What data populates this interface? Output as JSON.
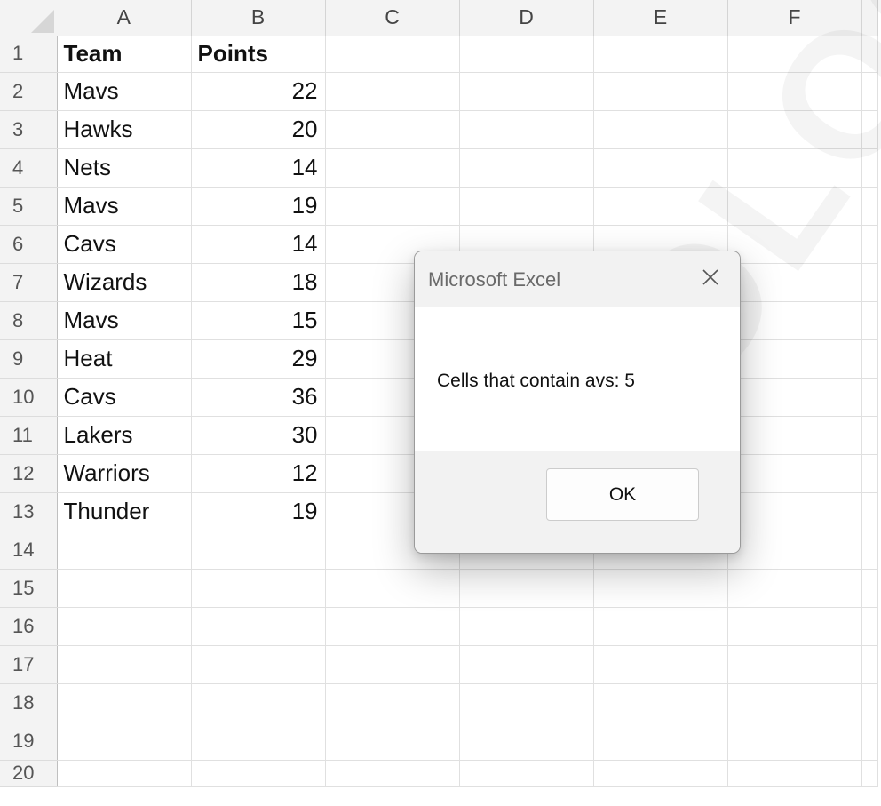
{
  "spreadsheet": {
    "columns": [
      "A",
      "B",
      "C",
      "D",
      "E",
      "F"
    ],
    "row_numbers": [
      "1",
      "2",
      "3",
      "4",
      "5",
      "6",
      "7",
      "8",
      "9",
      "10",
      "11",
      "12",
      "13",
      "14",
      "15",
      "16",
      "17",
      "18",
      "19",
      "20"
    ],
    "rows": [
      [
        "Team",
        "Points"
      ],
      [
        "Mavs",
        "22"
      ],
      [
        "Hawks",
        "20"
      ],
      [
        "Nets",
        "14"
      ],
      [
        "Mavs",
        "19"
      ],
      [
        "Cavs",
        "14"
      ],
      [
        "Wizards",
        "18"
      ],
      [
        "Mavs",
        "15"
      ],
      [
        "Heat",
        "29"
      ],
      [
        "Cavs",
        "36"
      ],
      [
        "Lakers",
        "30"
      ],
      [
        "Warriors",
        "12"
      ],
      [
        "Thunder",
        "19"
      ]
    ]
  },
  "dialog": {
    "title": "Microsoft Excel",
    "message": "Cells that contain avs: 5",
    "ok_label": "OK"
  },
  "watermark": "HOLOGY.C"
}
